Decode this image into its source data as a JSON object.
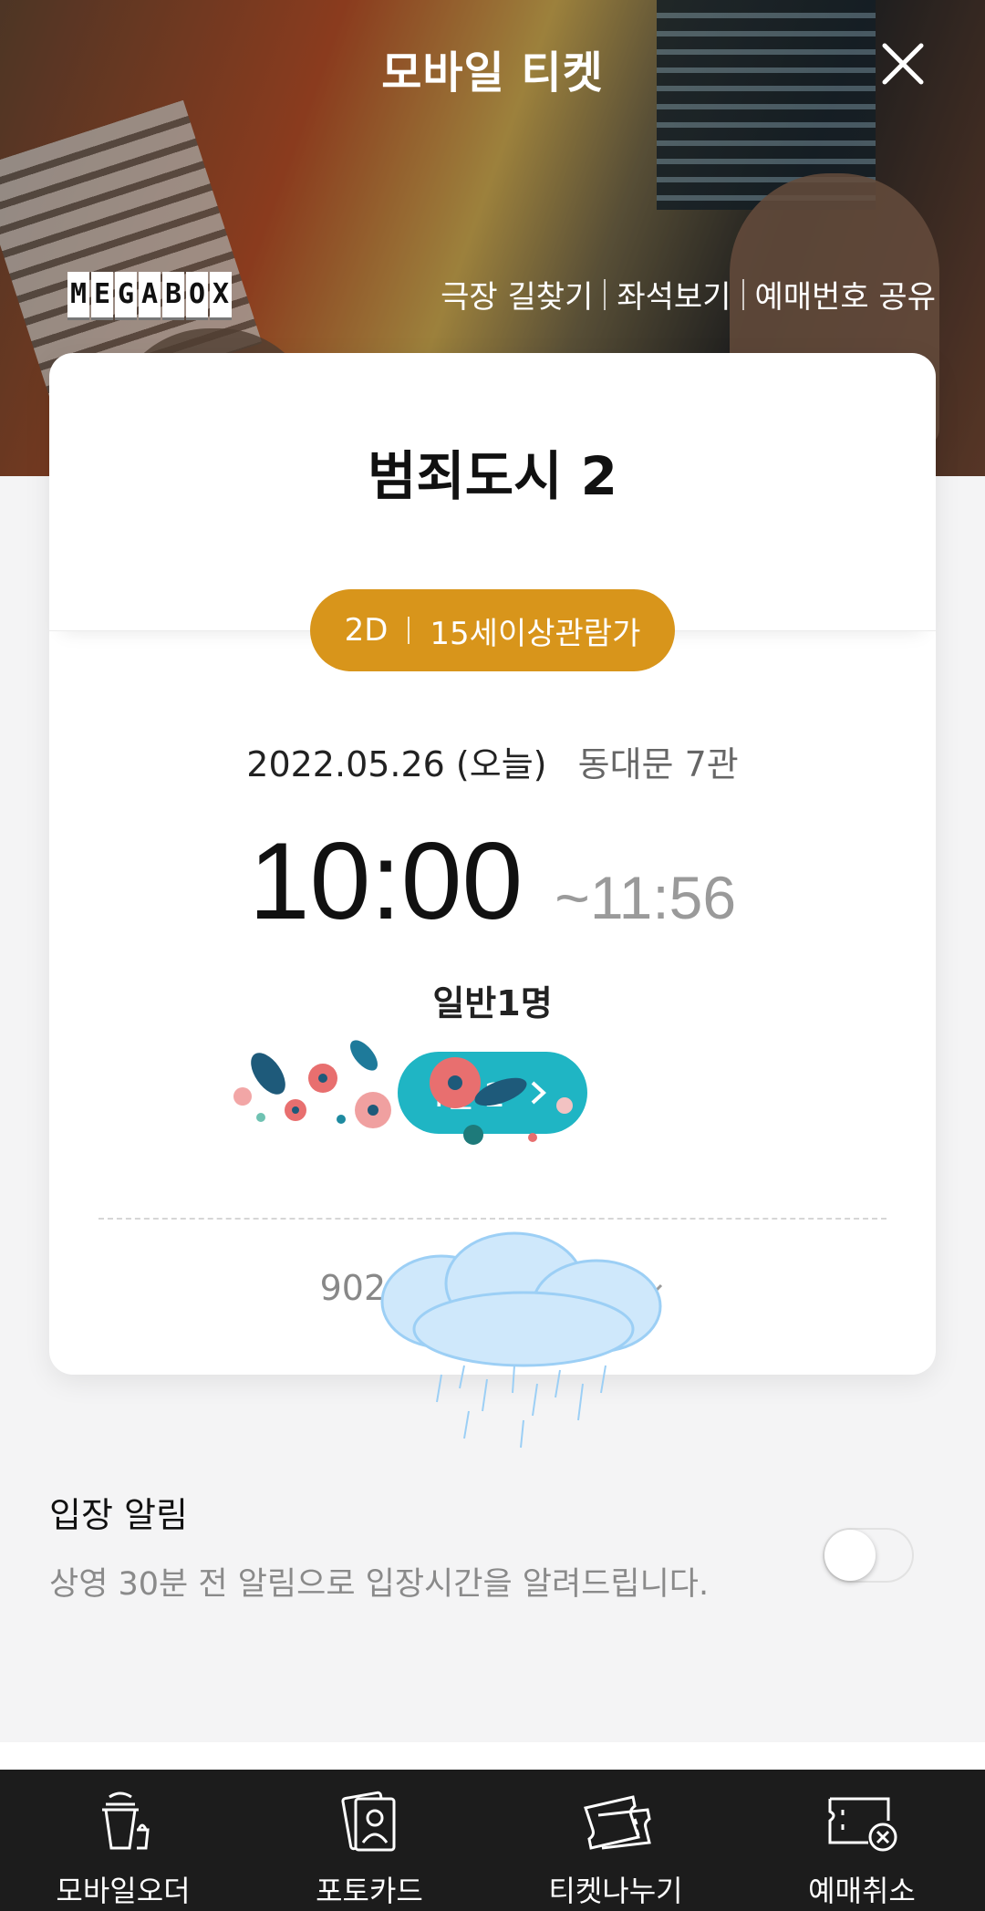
{
  "header": {
    "title": "모바일 티켓",
    "brand_letters": [
      "M",
      "E",
      "G",
      "A",
      "B",
      "O",
      "X"
    ],
    "links": [
      "극장 길찾기",
      "좌석보기",
      "예매번호 공유"
    ]
  },
  "ticket": {
    "movie_title": "범죄도시 2",
    "format": "2D",
    "rating": "15세이상관람가",
    "date": "2022.05.26 (오늘)",
    "theater": "동대문 7관",
    "start_time": "10:00",
    "end_time": "~11:56",
    "audience": "일반1명",
    "seat": "I열 2",
    "booking_number": "9024"
  },
  "notification": {
    "title": "입장 알림",
    "description": "상영 30분 전 알림으로 입장시간을 알려드립니다.",
    "enabled": false
  },
  "bottom_nav": [
    {
      "label": "모바일오더",
      "icon": "drink-cup-icon"
    },
    {
      "label": "포토카드",
      "icon": "photo-card-icon"
    },
    {
      "label": "티켓나누기",
      "icon": "ticket-share-icon"
    },
    {
      "label": "예매취소",
      "icon": "ticket-cancel-icon"
    }
  ],
  "colors": {
    "badge": "#d8951b",
    "seat_pill": "#1fb5c4",
    "nav_background": "#1c1c1c"
  }
}
